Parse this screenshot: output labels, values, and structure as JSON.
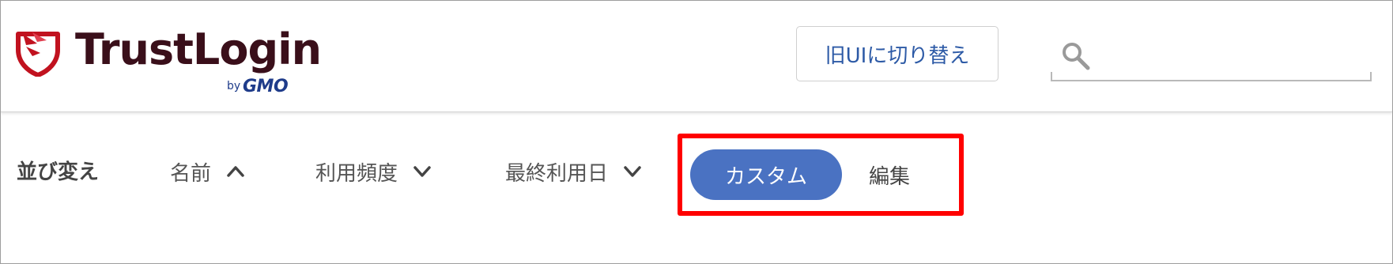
{
  "brand": {
    "name": "TrustLogin",
    "by": "by",
    "company": "GMO",
    "colors": {
      "mark": "#c1121f",
      "text": "#3a0f1a",
      "gmo": "#1f3c8a"
    }
  },
  "header": {
    "switch_label": "旧UIに切り替え",
    "search": {
      "value": "",
      "placeholder": ""
    }
  },
  "sortbar": {
    "label": "並び変え",
    "items": [
      {
        "label": "名前",
        "icon": "chevron-up-icon"
      },
      {
        "label": "利用頻度",
        "icon": "chevron-down-icon"
      },
      {
        "label": "最終利用日",
        "icon": "chevron-down-icon"
      }
    ],
    "custom_label": "カスタム",
    "edit_label": "編集"
  },
  "colors": {
    "accent": "#4a72c2",
    "switch_text": "#2d5aa6",
    "highlight": "#ff0000"
  }
}
